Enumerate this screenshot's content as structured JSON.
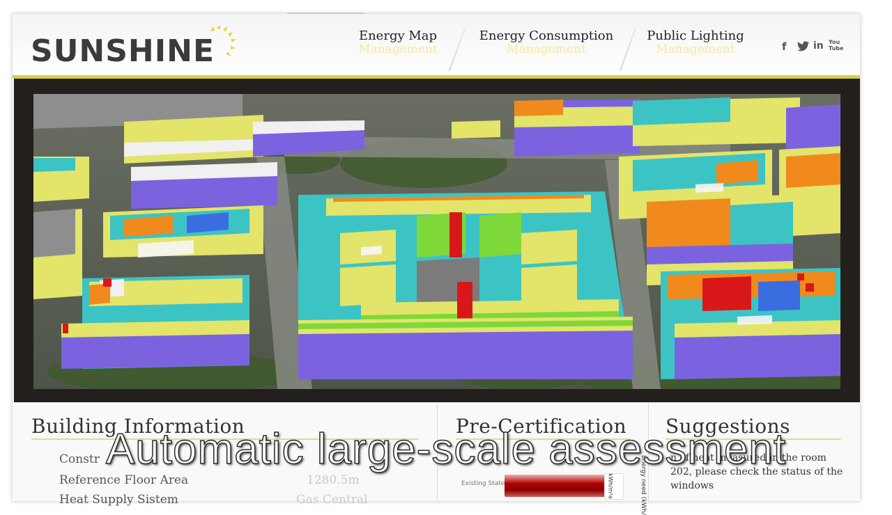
{
  "app": {
    "logo_text": "SUNSHINE"
  },
  "nav": {
    "items": [
      {
        "title": "Energy Map",
        "sub": "Management"
      },
      {
        "title": "Energy Consumption",
        "sub": "Management"
      },
      {
        "title": "Public Lighting",
        "sub": "Management"
      }
    ],
    "social": {
      "facebook": "f",
      "twitter": "t",
      "linkedin": "in",
      "youtube": "You Tube"
    }
  },
  "colors": {
    "accent": "#d8cf45",
    "nav_sub": "#f1ea9c",
    "roof_purple": "#7b63e0",
    "roof_yellow": "#e3e46a",
    "roof_cyan": "#3cc4c4",
    "roof_green": "#7ed83a",
    "roof_orange": "#f08a1c",
    "roof_red": "#d81818",
    "roof_blue": "#3a6ee0"
  },
  "building_info": {
    "title": "Building Information",
    "rows": [
      {
        "label": "Constr",
        "value": ""
      },
      {
        "label": "Reference Floor Area",
        "value": "1280.5m"
      },
      {
        "label": "Heat Supply Sistem",
        "value": "Gas Central"
      }
    ]
  },
  "precert": {
    "title": "Pre-Certification",
    "bar_label": "Existing State",
    "axis_text_a": "kWh/m²a",
    "axis_text_b": "Energy need (kWh/"
  },
  "suggestions": {
    "title": "Suggestions",
    "text": "n of heat measured in the room 202, please check the status of the windows"
  },
  "caption": "Automatic large-scale assessment"
}
